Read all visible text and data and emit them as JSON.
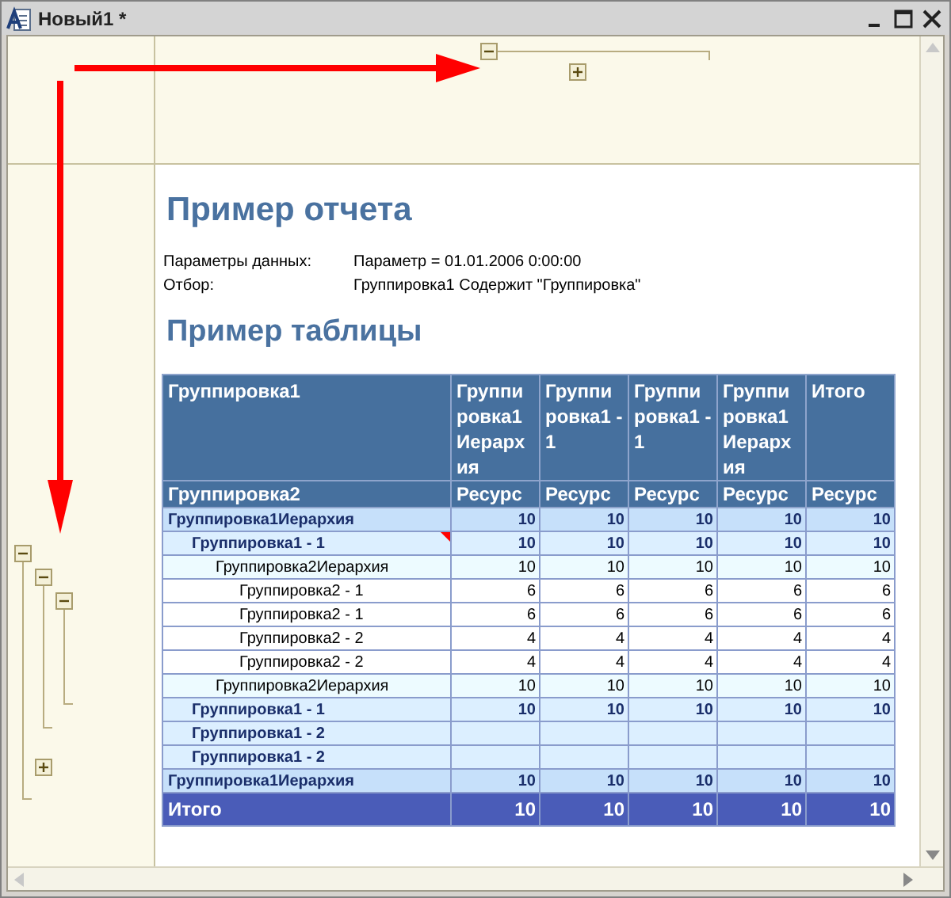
{
  "window": {
    "title": "Новый1 *"
  },
  "column_groups": [
    {
      "expanded": true
    },
    {
      "expanded": false
    }
  ],
  "report": {
    "title": "Пример отчета",
    "parameters": [
      {
        "label": "Параметры данных:",
        "value": "Параметр = 01.01.2006 0:00:00"
      },
      {
        "label": "Отбор:",
        "value": "Группировка1 Содержит \"Группировка\""
      }
    ],
    "table_title": "Пример таблицы"
  },
  "table": {
    "header_row_1": [
      "Группировка1",
      "Группи ровка1 Иерарх ия",
      "Группи ровка1 - 1",
      "Группи ровка1 - 1",
      "Группи ровка1 Иерарх ия",
      "Итого"
    ],
    "header_row_2": [
      "Группировка2",
      "Ресурс",
      "Ресурс",
      "Ресурс",
      "Ресурс",
      "Ресурс"
    ],
    "rows": [
      {
        "kind": "group1",
        "expanded": true,
        "note": false,
        "cells": [
          "Группировка1Иерархия",
          "10",
          "10",
          "10",
          "10",
          "10"
        ]
      },
      {
        "kind": "group1_item",
        "expanded": true,
        "note": true,
        "cells": [
          "Группировка1 - 1",
          "10",
          "10",
          "10",
          "10",
          "10"
        ]
      },
      {
        "kind": "group2",
        "expanded": true,
        "note": false,
        "cells": [
          "Группировка2Иерархия",
          "10",
          "10",
          "10",
          "10",
          "10"
        ]
      },
      {
        "kind": "detail",
        "note": false,
        "cells": [
          "Группировка2 - 1",
          "6",
          "6",
          "6",
          "6",
          "6"
        ]
      },
      {
        "kind": "detail",
        "note": false,
        "cells": [
          "Группировка2 - 1",
          "6",
          "6",
          "6",
          "6",
          "6"
        ]
      },
      {
        "kind": "detail",
        "note": false,
        "cells": [
          "Группировка2 - 2",
          "4",
          "4",
          "4",
          "4",
          "4"
        ]
      },
      {
        "kind": "detail",
        "note": false,
        "cells": [
          "Группировка2 - 2",
          "4",
          "4",
          "4",
          "4",
          "4"
        ]
      },
      {
        "kind": "group2",
        "note": false,
        "cells": [
          "Группировка2Иерархия",
          "10",
          "10",
          "10",
          "10",
          "10"
        ]
      },
      {
        "kind": "group1_item",
        "note": false,
        "cells": [
          "Группировка1 - 1",
          "10",
          "10",
          "10",
          "10",
          "10"
        ]
      },
      {
        "kind": "group1_item",
        "expanded": false,
        "note": false,
        "cells": [
          "Группировка1 - 2"
        ]
      },
      {
        "kind": "group1_item",
        "note": false,
        "cells": [
          "Группировка1 - 2"
        ]
      },
      {
        "kind": "group1",
        "note": false,
        "cells": [
          "Группировка1Иерархия",
          "10",
          "10",
          "10",
          "10",
          "10"
        ]
      },
      {
        "kind": "total",
        "note": false,
        "cells": [
          "Итого",
          "10",
          "10",
          "10",
          "10",
          "10"
        ]
      }
    ]
  }
}
